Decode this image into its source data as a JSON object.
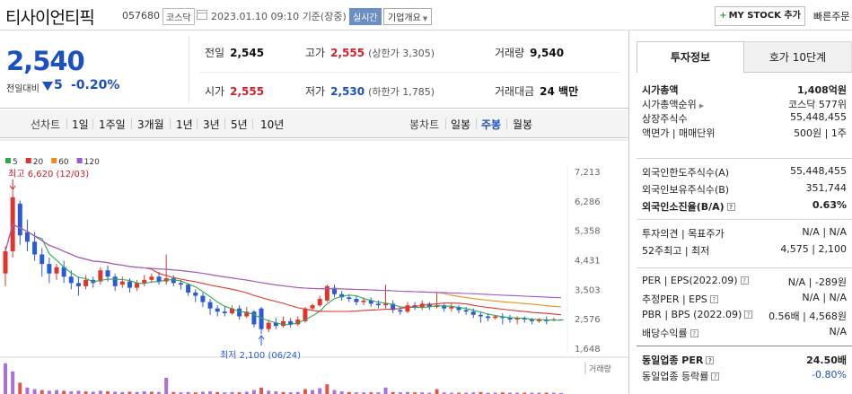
{
  "header": {
    "stock_name": "티사이언티픽",
    "stock_code": "057680",
    "market": "코스닥",
    "datetime": "2023.01.10 09:10",
    "basis": "기준(장중)",
    "realtime_badge": "실시간",
    "company_info_button": "기업개요",
    "mystock_button": "MY STOCK 추가",
    "sub_tab": "빠른주문"
  },
  "summary": {
    "price": "2,540",
    "change_label": "전일대비",
    "change_value": "5",
    "change_percent": "-0.20%",
    "prev_close_label": "전일",
    "prev_close": "2,545",
    "high_label": "고가",
    "high": "2,555",
    "upper_limit": "(상한가 3,305)",
    "volume_label": "거래량",
    "volume": "9,540",
    "open_label": "시가",
    "open": "2,555",
    "low_label": "저가",
    "low": "2,530",
    "lower_limit": "(하한가 1,785)",
    "amount_label": "거래대금",
    "amount": "24 백만"
  },
  "toolbar": {
    "line_label": "선차트",
    "periods": [
      "1일",
      "1주일",
      "3개월",
      "1년",
      "3년",
      "5년",
      "10년"
    ],
    "candle_label": "봉차트",
    "candle_periods": [
      "일봉",
      "주봉",
      "월봉"
    ],
    "active_candle": "주봉"
  },
  "chart_data": {
    "type": "candlestick",
    "legend": [
      {
        "name": "5",
        "color": "#2fa84f"
      },
      {
        "name": "20",
        "color": "#e0352d"
      },
      {
        "name": "60",
        "color": "#f08c1c"
      },
      {
        "name": "120",
        "color": "#9b59d0"
      }
    ],
    "y_ticks": [
      7213,
      6286,
      5358,
      4431,
      3503,
      2576,
      1648
    ],
    "ylim": [
      1648,
      7213
    ],
    "annotation_high": "최고 6,620 (12/03)",
    "annotation_low": "최저 2,100 (06/24)",
    "volume_label": "거래량",
    "candles": [
      {
        "o": 4000,
        "c": 4700,
        "h": 4850,
        "l": 3600
      },
      {
        "o": 4700,
        "c": 6400,
        "h": 6620,
        "l": 4500
      },
      {
        "o": 6200,
        "c": 5200,
        "h": 6300,
        "l": 4900
      },
      {
        "o": 5300,
        "c": 5000,
        "h": 5700,
        "l": 4700
      },
      {
        "o": 5000,
        "c": 4600,
        "h": 5300,
        "l": 4400
      },
      {
        "o": 4600,
        "c": 4300,
        "h": 4800,
        "l": 3900
      },
      {
        "o": 4300,
        "c": 4000,
        "h": 4500,
        "l": 3700
      },
      {
        "o": 4000,
        "c": 4200,
        "h": 4300,
        "l": 3800
      },
      {
        "o": 4200,
        "c": 3900,
        "h": 4400,
        "l": 3700
      },
      {
        "o": 3900,
        "c": 3700,
        "h": 4100,
        "l": 3500
      },
      {
        "o": 3700,
        "c": 3600,
        "h": 3900,
        "l": 3300
      },
      {
        "o": 3600,
        "c": 3800,
        "h": 3950,
        "l": 3500
      },
      {
        "o": 3800,
        "c": 3700,
        "h": 3900,
        "l": 3550
      },
      {
        "o": 3750,
        "c": 4100,
        "h": 4200,
        "l": 3650
      },
      {
        "o": 4100,
        "c": 3900,
        "h": 4250,
        "l": 3750
      },
      {
        "o": 3900,
        "c": 3600,
        "h": 4000,
        "l": 3450
      },
      {
        "o": 3650,
        "c": 3750,
        "h": 3900,
        "l": 3550
      },
      {
        "o": 3750,
        "c": 3550,
        "h": 3850,
        "l": 3400
      },
      {
        "o": 3550,
        "c": 3700,
        "h": 3800,
        "l": 3450
      },
      {
        "o": 3700,
        "c": 3800,
        "h": 3950,
        "l": 3600
      },
      {
        "o": 3800,
        "c": 3900,
        "h": 4000,
        "l": 3700
      },
      {
        "o": 3900,
        "c": 3750,
        "h": 4050,
        "l": 3650
      },
      {
        "o": 3750,
        "c": 3850,
        "h": 4600,
        "l": 3650
      },
      {
        "o": 3850,
        "c": 3700,
        "h": 3950,
        "l": 3600
      },
      {
        "o": 3700,
        "c": 3650,
        "h": 3800,
        "l": 3500
      },
      {
        "o": 3650,
        "c": 3400,
        "h": 3700,
        "l": 3300
      },
      {
        "o": 3400,
        "c": 3300,
        "h": 3500,
        "l": 3100
      },
      {
        "o": 3300,
        "c": 3100,
        "h": 3400,
        "l": 2950
      },
      {
        "o": 3100,
        "c": 2900,
        "h": 3200,
        "l": 2700
      },
      {
        "o": 2900,
        "c": 2800,
        "h": 3000,
        "l": 2650
      },
      {
        "o": 2800,
        "c": 2750,
        "h": 2950,
        "l": 2650
      },
      {
        "o": 2750,
        "c": 2900,
        "h": 3000,
        "l": 2700
      },
      {
        "o": 2900,
        "c": 2650,
        "h": 3000,
        "l": 2550
      },
      {
        "o": 2650,
        "c": 2800,
        "h": 2950,
        "l": 2600
      },
      {
        "o": 2800,
        "c": 2400,
        "h": 2850,
        "l": 2300
      },
      {
        "o": 2900,
        "c": 2250,
        "h": 2950,
        "l": 2100
      },
      {
        "o": 2250,
        "c": 2450,
        "h": 2550,
        "l": 2150
      },
      {
        "o": 2450,
        "c": 2350,
        "h": 2600,
        "l": 2250
      },
      {
        "o": 2350,
        "c": 2500,
        "h": 2650,
        "l": 2300
      },
      {
        "o": 2500,
        "c": 2400,
        "h": 2600,
        "l": 2300
      },
      {
        "o": 2400,
        "c": 2550,
        "h": 2650,
        "l": 2350
      },
      {
        "o": 2500,
        "c": 2900,
        "h": 2950,
        "l": 2450
      },
      {
        "o": 2900,
        "c": 3000,
        "h": 3050,
        "l": 2850
      },
      {
        "o": 3000,
        "c": 3200,
        "h": 3300,
        "l": 2950
      },
      {
        "o": 3150,
        "c": 3600,
        "h": 3650,
        "l": 3100
      },
      {
        "o": 3550,
        "c": 3350,
        "h": 3650,
        "l": 3250
      },
      {
        "o": 3350,
        "c": 3250,
        "h": 3450,
        "l": 3150
      },
      {
        "o": 3250,
        "c": 3200,
        "h": 3350,
        "l": 3100
      },
      {
        "o": 3200,
        "c": 3100,
        "h": 3300,
        "l": 3000
      },
      {
        "o": 3100,
        "c": 3150,
        "h": 3250,
        "l": 3000
      },
      {
        "o": 3150,
        "c": 3050,
        "h": 3250,
        "l": 2950
      },
      {
        "o": 3050,
        "c": 3000,
        "h": 3150,
        "l": 2900
      },
      {
        "o": 3000,
        "c": 3050,
        "h": 3650,
        "l": 2900
      },
      {
        "o": 3050,
        "c": 2850,
        "h": 3150,
        "l": 2750
      },
      {
        "o": 2850,
        "c": 2800,
        "h": 2950,
        "l": 2700
      },
      {
        "o": 2800,
        "c": 3000,
        "h": 3100,
        "l": 2750
      },
      {
        "o": 3000,
        "c": 2950,
        "h": 3100,
        "l": 2850
      },
      {
        "o": 2950,
        "c": 3050,
        "h": 3150,
        "l": 2850
      },
      {
        "o": 3050,
        "c": 2950,
        "h": 3100,
        "l": 2850
      },
      {
        "o": 2950,
        "c": 3000,
        "h": 3400,
        "l": 2900
      },
      {
        "o": 3000,
        "c": 2900,
        "h": 3050,
        "l": 2800
      },
      {
        "o": 2900,
        "c": 2950,
        "h": 3050,
        "l": 2800
      },
      {
        "o": 2950,
        "c": 2850,
        "h": 3000,
        "l": 2750
      },
      {
        "o": 2850,
        "c": 2800,
        "h": 2950,
        "l": 2700
      },
      {
        "o": 2800,
        "c": 2700,
        "h": 2900,
        "l": 2600
      },
      {
        "o": 2700,
        "c": 2650,
        "h": 2800,
        "l": 2450
      },
      {
        "o": 2650,
        "c": 2600,
        "h": 2750,
        "l": 2500
      },
      {
        "o": 2600,
        "c": 2650,
        "h": 2700,
        "l": 2550
      },
      {
        "o": 2650,
        "c": 2600,
        "h": 2750,
        "l": 2400
      },
      {
        "o": 2600,
        "c": 2550,
        "h": 2700,
        "l": 2450
      },
      {
        "o": 2550,
        "c": 2600,
        "h": 2650,
        "l": 2400
      },
      {
        "o": 2600,
        "c": 2550,
        "h": 2650,
        "l": 2450
      },
      {
        "o": 2550,
        "c": 2500,
        "h": 2600,
        "l": 2400
      },
      {
        "o": 2500,
        "c": 2550,
        "h": 2600,
        "l": 2450
      },
      {
        "o": 2550,
        "c": 2500,
        "h": 2650,
        "l": 2400
      },
      {
        "o": 2520,
        "c": 2560,
        "h": 2600,
        "l": 2500
      },
      {
        "o": 2555,
        "c": 2540,
        "h": 2555,
        "l": 2530
      }
    ],
    "volume_bars": [
      0.95,
      0.7,
      0.35,
      0.2,
      0.15,
      0.12,
      0.1,
      0.12,
      0.1,
      0.08,
      0.1,
      0.08,
      0.07,
      0.1,
      0.08,
      0.07,
      0.06,
      0.07,
      0.06,
      0.08,
      0.07,
      0.06,
      0.5,
      0.06,
      0.05,
      0.06,
      0.05,
      0.07,
      0.08,
      0.06,
      0.05,
      0.06,
      0.05,
      0.07,
      0.12,
      0.2,
      0.1,
      0.08,
      0.06,
      0.05,
      0.06,
      0.15,
      0.12,
      0.18,
      0.3,
      0.12,
      0.08,
      0.06,
      0.05,
      0.05,
      0.05,
      0.05,
      0.2,
      0.06,
      0.05,
      0.06,
      0.05,
      0.05,
      0.04,
      0.15,
      0.05,
      0.04,
      0.04,
      0.04,
      0.05,
      0.06,
      0.04,
      0.04,
      0.05,
      0.04,
      0.04,
      0.04,
      0.04,
      0.04,
      0.04,
      0.04,
      0.03
    ],
    "volume_colors": [
      "#9b59d0",
      "#9b59d0",
      "#e0352d"
    ]
  },
  "panel": {
    "tab_invest": "투자정보",
    "tab_hoga": "호가 10단계",
    "rows_a": [
      {
        "k": "시가총액",
        "v": "1,408억원",
        "bold": true
      },
      {
        "k": "시가총액순위",
        "v": "코스닥 577위",
        "arrow": true
      },
      {
        "k": "상장주식수",
        "v": "55,448,455"
      },
      {
        "k": "액면가 | 매매단위",
        "v": "500원 | 1주"
      }
    ],
    "rows_b": [
      {
        "k": "외국인한도주식수(A)",
        "v": "55,448,455"
      },
      {
        "k": "외국인보유주식수(B)",
        "v": "351,744"
      },
      {
        "k": "외국인소진율(B/A)",
        "v": "0.63%",
        "bold": true,
        "box": true
      }
    ],
    "rows_c": [
      {
        "k": "투자의견 | 목표주가",
        "v": "N/A | N/A"
      },
      {
        "k": "52주최고 | 최저",
        "v": "4,575 | 2,100"
      }
    ],
    "rows_d": [
      {
        "k": "PER | EPS(2022.09)",
        "v": "N/A | -289원",
        "box": true
      },
      {
        "k": "추정PER | EPS",
        "v": "N/A | N/A",
        "box": true
      },
      {
        "k": "PBR | BPS (2022.09)",
        "v": "0.56배 | 4,568원",
        "box": true
      },
      {
        "k": "배당수익률",
        "v": "N/A",
        "box": true
      }
    ],
    "rows_e": [
      {
        "k": "동일업종 PER",
        "v": "24.50배",
        "bold": true,
        "box": true
      },
      {
        "k": "동일업종 등락률",
        "v": "-0.80%",
        "box": true,
        "down": true
      }
    ]
  }
}
